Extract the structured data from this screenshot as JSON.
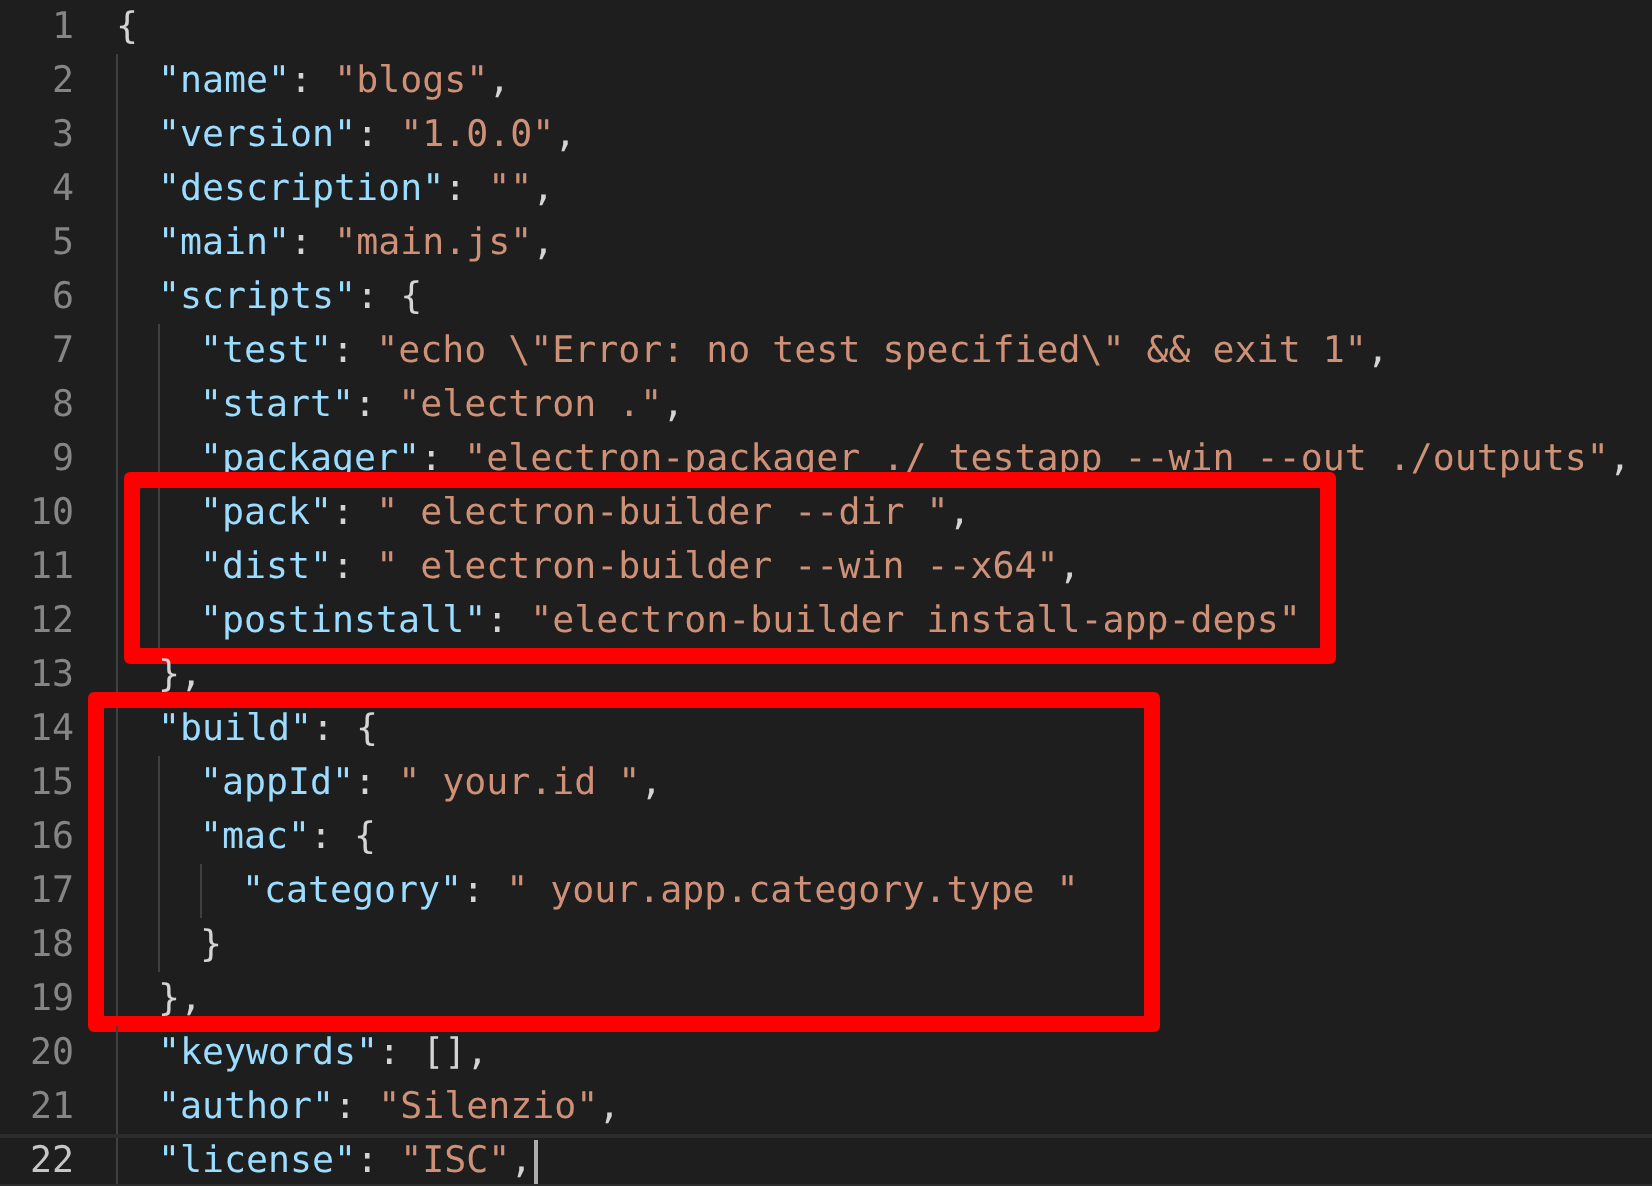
{
  "editor": {
    "lines": [
      {
        "kind": "line",
        "number": "1",
        "current": false,
        "tokens": [
          {
            "kind": "punct",
            "text": "{"
          }
        ],
        "children": [
          {
            "kind": "line",
            "number": "2",
            "current": false,
            "tokens": [
              {
                "kind": "key",
                "text": "\"name\""
              },
              {
                "kind": "punct",
                "text": ": "
              },
              {
                "kind": "string",
                "text": "\"blogs\""
              },
              {
                "kind": "punct",
                "text": ","
              }
            ]
          },
          {
            "kind": "line",
            "number": "3",
            "current": false,
            "tokens": [
              {
                "kind": "key",
                "text": "\"version\""
              },
              {
                "kind": "punct",
                "text": ": "
              },
              {
                "kind": "string",
                "text": "\"1.0.0\""
              },
              {
                "kind": "punct",
                "text": ","
              }
            ]
          },
          {
            "kind": "line",
            "number": "4",
            "current": false,
            "tokens": [
              {
                "kind": "key",
                "text": "\"description\""
              },
              {
                "kind": "punct",
                "text": ": "
              },
              {
                "kind": "string",
                "text": "\"\""
              },
              {
                "kind": "punct",
                "text": ","
              }
            ]
          },
          {
            "kind": "line",
            "number": "5",
            "current": false,
            "tokens": [
              {
                "kind": "key",
                "text": "\"main\""
              },
              {
                "kind": "punct",
                "text": ": "
              },
              {
                "kind": "string",
                "text": "\"main.js\""
              },
              {
                "kind": "punct",
                "text": ","
              }
            ]
          },
          {
            "kind": "line",
            "number": "6",
            "current": false,
            "tokens": [
              {
                "kind": "key",
                "text": "\"scripts\""
              },
              {
                "kind": "punct",
                "text": ": {"
              }
            ],
            "children": [
              {
                "kind": "line",
                "number": "7",
                "current": false,
                "tokens": [
                  {
                    "kind": "key",
                    "text": "\"test\""
                  },
                  {
                    "kind": "punct",
                    "text": ": "
                  },
                  {
                    "kind": "string",
                    "text": "\"echo \\\"Error: no test specified\\\" && exit 1\""
                  },
                  {
                    "kind": "punct",
                    "text": ","
                  }
                ]
              },
              {
                "kind": "line",
                "number": "8",
                "current": false,
                "tokens": [
                  {
                    "kind": "key",
                    "text": "\"start\""
                  },
                  {
                    "kind": "punct",
                    "text": ": "
                  },
                  {
                    "kind": "string",
                    "text": "\"electron .\""
                  },
                  {
                    "kind": "punct",
                    "text": ","
                  }
                ]
              },
              {
                "kind": "line",
                "number": "9",
                "current": false,
                "tokens": [
                  {
                    "kind": "key",
                    "text": "\"packager\""
                  },
                  {
                    "kind": "punct",
                    "text": ": "
                  },
                  {
                    "kind": "string",
                    "text": "\"electron-packager ./ testapp --win --out ./outputs\""
                  },
                  {
                    "kind": "punct",
                    "text": ","
                  }
                ]
              },
              {
                "kind": "highlight",
                "children": [
                  {
                    "kind": "line",
                    "number": "10",
                    "current": false,
                    "tokens": [
                      {
                        "kind": "key",
                        "text": "\"pack\""
                      },
                      {
                        "kind": "punct",
                        "text": ": "
                      },
                      {
                        "kind": "string",
                        "text": "\" electron-builder --dir \""
                      },
                      {
                        "kind": "punct",
                        "text": ","
                      }
                    ]
                  },
                  {
                    "kind": "line",
                    "number": "11",
                    "current": false,
                    "tokens": [
                      {
                        "kind": "key",
                        "text": "\"dist\""
                      },
                      {
                        "kind": "punct",
                        "text": ": "
                      },
                      {
                        "kind": "string",
                        "text": "\" electron-builder --win --x64\""
                      },
                      {
                        "kind": "punct",
                        "text": ","
                      }
                    ]
                  },
                  {
                    "kind": "line",
                    "number": "12",
                    "current": false,
                    "tokens": [
                      {
                        "kind": "key",
                        "text": "\"postinstall\""
                      },
                      {
                        "kind": "punct",
                        "text": ": "
                      },
                      {
                        "kind": "string",
                        "text": "\"electron-builder install-app-deps\""
                      }
                    ]
                  }
                ]
              }
            ]
          },
          {
            "kind": "line",
            "number": "13",
            "current": false,
            "tokens": [
              {
                "kind": "punct",
                "text": "},"
              }
            ]
          },
          {
            "kind": "highlight",
            "children": [
              {
                "kind": "line",
                "number": "14",
                "current": false,
                "tokens": [
                  {
                    "kind": "key",
                    "text": "\"build\""
                  },
                  {
                    "kind": "punct",
                    "text": ": {"
                  }
                ],
                "children": [
                  {
                    "kind": "line",
                    "number": "15",
                    "current": false,
                    "tokens": [
                      {
                        "kind": "key",
                        "text": "\"appId\""
                      },
                      {
                        "kind": "punct",
                        "text": ": "
                      },
                      {
                        "kind": "string",
                        "text": "\" your.id \""
                      },
                      {
                        "kind": "punct",
                        "text": ","
                      }
                    ]
                  },
                  {
                    "kind": "line",
                    "number": "16",
                    "current": false,
                    "tokens": [
                      {
                        "kind": "key",
                        "text": "\"mac\""
                      },
                      {
                        "kind": "punct",
                        "text": ": {"
                      }
                    ],
                    "children": [
                      {
                        "kind": "line",
                        "number": "17",
                        "current": false,
                        "tokens": [
                          {
                            "kind": "key",
                            "text": "\"category\""
                          },
                          {
                            "kind": "punct",
                            "text": ": "
                          },
                          {
                            "kind": "string",
                            "text": "\" your.app.category.type \""
                          }
                        ]
                      }
                    ]
                  },
                  {
                    "kind": "line",
                    "number": "18",
                    "current": false,
                    "tokens": [
                      {
                        "kind": "punct",
                        "text": "}"
                      }
                    ]
                  }
                ]
              },
              {
                "kind": "line",
                "number": "19",
                "current": false,
                "tokens": [
                  {
                    "kind": "punct",
                    "text": "},"
                  }
                ]
              }
            ]
          },
          {
            "kind": "line",
            "number": "20",
            "current": false,
            "tokens": [
              {
                "kind": "key",
                "text": "\"keywords\""
              },
              {
                "kind": "punct",
                "text": ": "
              },
              {
                "kind": "punct",
                "text": "[]"
              },
              {
                "kind": "punct",
                "text": ","
              }
            ]
          },
          {
            "kind": "line",
            "number": "21",
            "current": false,
            "tokens": [
              {
                "kind": "key",
                "text": "\"author\""
              },
              {
                "kind": "punct",
                "text": ": "
              },
              {
                "kind": "string",
                "text": "\"Silenzio\""
              },
              {
                "kind": "punct",
                "text": ","
              }
            ]
          },
          {
            "kind": "line",
            "number": "22",
            "current": true,
            "tokens": [
              {
                "kind": "key",
                "text": "\"license\""
              },
              {
                "kind": "punct",
                "text": ": "
              },
              {
                "kind": "string",
                "text": "\"ISC\""
              },
              {
                "kind": "punct",
                "text": ","
              }
            ]
          }
        ]
      }
    ]
  }
}
